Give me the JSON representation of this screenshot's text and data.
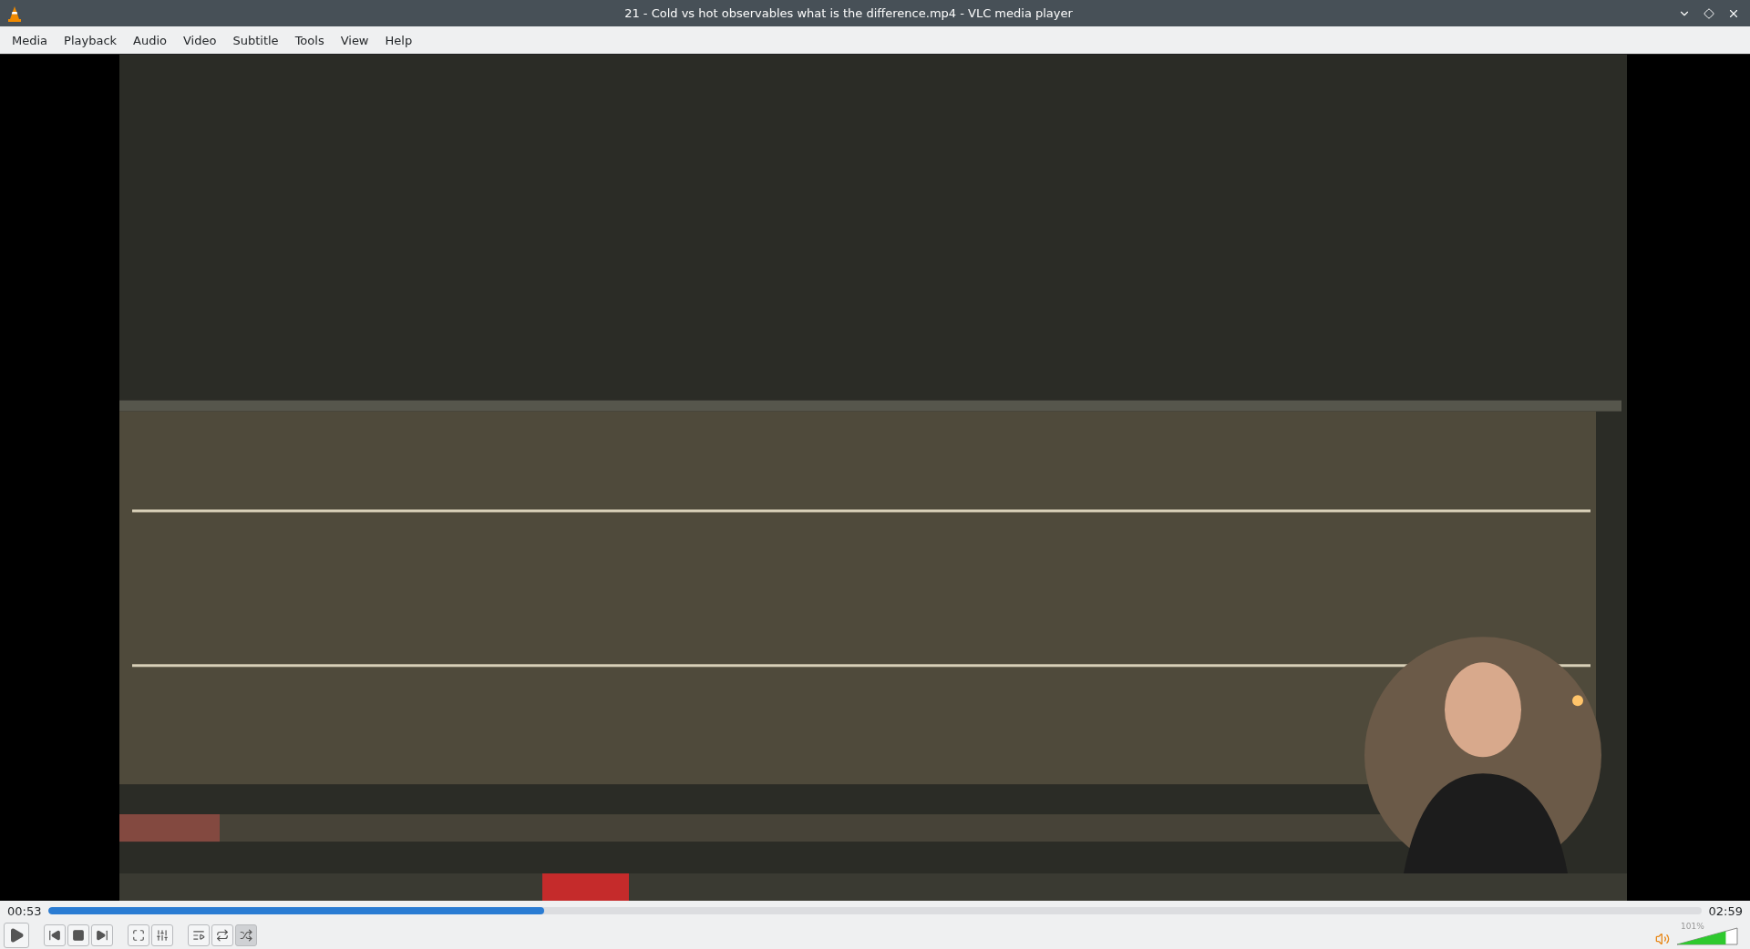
{
  "window": {
    "title": "21 - Cold vs hot observables what is the difference.mp4 - VLC media player"
  },
  "menu": [
    "Media",
    "Playback",
    "Audio",
    "Video",
    "Subtitle",
    "Tools",
    "View",
    "Help"
  ],
  "video": {
    "kind": "picture"
  },
  "seek": {
    "elapsed": "00:53",
    "total": "02:59",
    "level": 0.3
  },
  "controls": [
    {
      "kind": "play"
    },
    {
      "kind": "prev"
    },
    {
      "kind": "stop"
    },
    {
      "kind": "next"
    },
    {
      "kind": "fullscreen"
    },
    {
      "kind": "extended"
    },
    {
      "kind": "playlist"
    },
    {
      "kind": "loop",
      "on": false
    },
    {
      "kind": "shuffle",
      "on": true
    }
  ],
  "volume": {
    "reading": "101%",
    "level": 0.81
  }
}
